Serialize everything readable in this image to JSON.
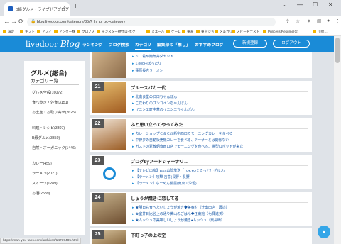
{
  "browser": {
    "tab_title": "B級グルメ・ライブドアブログ",
    "tab_close": "×",
    "new_tab": "+",
    "window_controls": [
      "⌄",
      "—",
      "☐",
      "✕"
    ],
    "url": "blog.livedoor.com/category/35/?_h_jp_pc=category",
    "nav_icons": [
      "←",
      "→",
      "⟳"
    ]
  },
  "bookmarks": [
    "設定",
    "ギフト",
    "アフィ",
    "アンダー株",
    "クロノス",
    "モンスター観サロ-ポク",
    "ヌユール",
    "ゲーム",
    "東海",
    "東京ジョ",
    "メルカリ",
    "スピードテスト",
    "Princess Resume(G)",
    "川崎…"
  ],
  "site": {
    "logo_text": "livedoor",
    "logo_script": "Blog",
    "nav": [
      "ランキング",
      "ブログ検索",
      "カテゴリ",
      "編集部の「推し」",
      "おすすめブログ"
    ],
    "nav_active_index": 2,
    "register_button": "新規登録",
    "login_button": "ログアウト",
    "accent_color": "#1a8bd7"
  },
  "sidebar": {
    "title": "グルメ(総合)",
    "subtitle": "カテゴリー覧",
    "categories": [
      "グルメ全般(16072)",
      "食べ歩き・外食(3151)",
      "お土産・お取り寄せ(2625)",
      "料理・レシピ(3307)",
      "B級グルメ(3350)",
      "自然・オーガニック(1446)",
      "カレー(459)",
      "ラーメン(2021)",
      "スイーツ(1289)",
      "お酒(2589)"
    ]
  },
  "feed": {
    "top_items": [
      "ミニ着め簡気弁ダセット",
      "1,000円ぽったり",
      "蓮原長吉ラーメン"
    ],
    "cards": [
      {
        "num": "21",
        "title": "ブルースバカー代",
        "items": [
          "北南食堂の旧口ちゃんぽん",
          "こだわりのワンコインちゃんぽん",
          "イニシエ町中華のイニシエちゃんぽん"
        ]
      },
      {
        "num": "22",
        "title": "ふと思い立ってやってみた…",
        "items": [
          "カレーショップＣ＆Ｃ@新宿西口でモーニングカレーを食べる",
          "中野夢の自動販売機カレーを食べる、アーサーとは関係ない",
          "ガストの素敵朝食西口店でモーニングを食べる、猫型ロボットが来た"
        ]
      },
      {
        "num": "23",
        "title": "ブログbyフードジャーナリ…",
        "items": [
          "【テレビ出演】BSS山陰放送「TOKYOくるっと！グルメ」",
          "【ラーメン】攻撃 吉富(長野・長野)",
          "【ラーメン】らーめん桃屋(東京・汐留)"
        ]
      },
      {
        "num": "24",
        "title": "しょうが焼きに恋してる",
        "items": [
          "★明日も食べたいしょうが焼き◆美春や（辻出田店・再訪）",
          "★室井日比谷上の通り黄山のごはん◆正東館（七拝進美）",
          "★ムッシュの美味しいしょうが焼き●ムッシュ（東長崎）"
        ]
      },
      {
        "num": "25",
        "title": "下町っ子の上の空",
        "items": []
      }
    ]
  },
  "status_url": "https://man-you-fans.com/archives/14739485.html",
  "to_top": "▲"
}
